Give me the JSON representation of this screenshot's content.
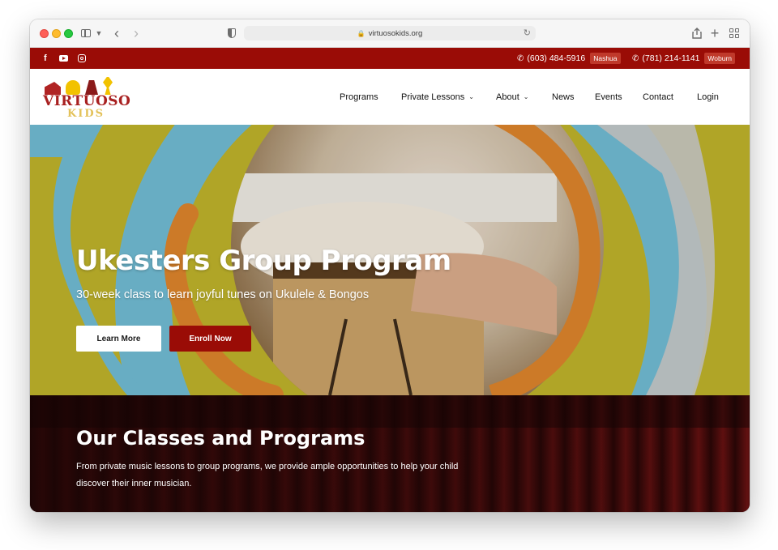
{
  "browser": {
    "url": "virtuosokids.org"
  },
  "topbar": {
    "social": [
      {
        "icon": "facebook-icon",
        "glyph": "f"
      },
      {
        "icon": "youtube-icon"
      },
      {
        "icon": "instagram-icon"
      }
    ],
    "phones": [
      {
        "number": "(603) 484-5916",
        "location": "Nashua"
      },
      {
        "number": "(781) 214-1141",
        "location": "Woburn"
      }
    ]
  },
  "logo": {
    "main": "VIRTUOSO",
    "sub": "KIDS"
  },
  "nav": {
    "items": [
      {
        "label": "Programs",
        "dropdown": false
      },
      {
        "label": "Private Lessons",
        "dropdown": true
      },
      {
        "label": "About",
        "dropdown": true
      },
      {
        "label": "News",
        "dropdown": false
      },
      {
        "label": "Events",
        "dropdown": false
      },
      {
        "label": "Contact",
        "dropdown": false
      },
      {
        "label": "Login",
        "dropdown": false
      }
    ]
  },
  "hero": {
    "title": "Ukesters Group Program",
    "subtitle": "30-week class to learn joyful tunes on Ukulele & Bongos",
    "learn_more": "Learn More",
    "enroll_now": "Enroll Now"
  },
  "classes": {
    "title": "Our Classes and Programs",
    "description": "From private music lessons to group programs, we provide ample opportunities to help your child discover their inner musician."
  },
  "colors": {
    "brand_red": "#9a0c06",
    "hero_olive": "#bbb02a",
    "hero_blue": "#6fb8d0",
    "hero_orange": "#d9822b",
    "logo_gold": "#e3c25a"
  }
}
